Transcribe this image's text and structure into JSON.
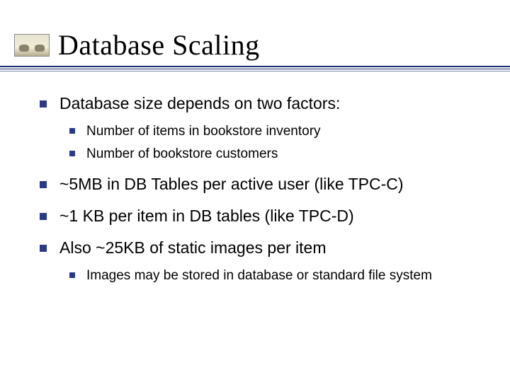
{
  "title": "Database Scaling",
  "bullets": [
    {
      "text": "Database size depends on two factors:",
      "sub": [
        "Number of items in bookstore inventory",
        "Number of bookstore customers"
      ]
    },
    {
      "text": "~5MB in DB Tables per active user (like TPC-C)"
    },
    {
      "text": "~1 KB per item in DB tables (like TPC-D)"
    },
    {
      "text": "Also ~25KB of static images per item",
      "sub": [
        "Images may be stored in database or standard file system"
      ]
    }
  ]
}
